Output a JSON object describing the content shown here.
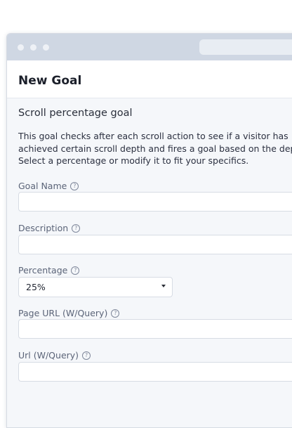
{
  "panel": {
    "title": "New Goal",
    "section_title": "Scroll percentage goal",
    "description_lines": [
      "This goal checks after each scroll action to see if a visitor has",
      "achieved certain scroll depth and fires a goal based on the dep",
      "Select a percentage or modify it to fit your specifics."
    ]
  },
  "fields": {
    "goal_name": {
      "label": "Goal Name",
      "value": ""
    },
    "description": {
      "label": "Description",
      "value": ""
    },
    "percentage": {
      "label": "Percentage",
      "value": "25%"
    },
    "page_url": {
      "label": "Page URL (W/Query)",
      "value": ""
    },
    "url": {
      "label": "Url (W/Query)",
      "value": ""
    }
  },
  "icons": {
    "help": "question-circle-icon",
    "dropdown": "caret-down-icon"
  },
  "colors": {
    "titlebar": "#cfd7e3",
    "panel_bg": "#f5f7fa",
    "label": "#5b6478"
  }
}
